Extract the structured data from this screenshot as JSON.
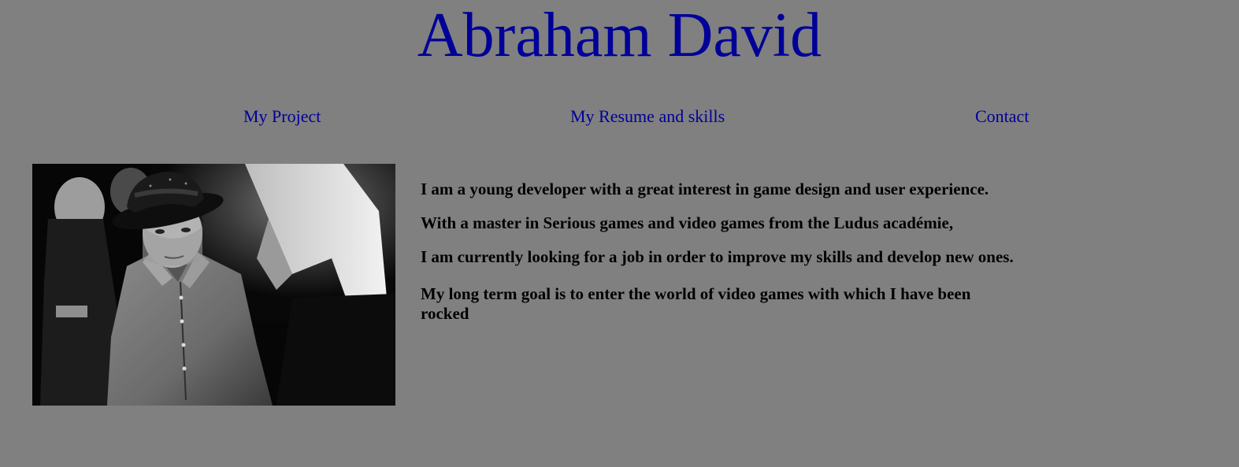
{
  "header": {
    "title": "Abraham David"
  },
  "nav": {
    "items": [
      {
        "label": "My Project"
      },
      {
        "label": "My Resume and skills"
      },
      {
        "label": "Contact"
      }
    ]
  },
  "profile_photo": {
    "icon": "photo-of-person-in-hat"
  },
  "bio": {
    "paragraphs": [
      "I am a young developer with a great interest in game design and user experience.",
      "With a master in Serious games and video games from the Ludus académie,",
      "I am currently looking for a job in order to improve my skills and develop new ones.",
      "My long term goal is to enter the world of video games with which I have been rocked"
    ]
  },
  "colors": {
    "background": "#808080",
    "title": "#000099",
    "link": "#000099",
    "text": "#000000"
  }
}
